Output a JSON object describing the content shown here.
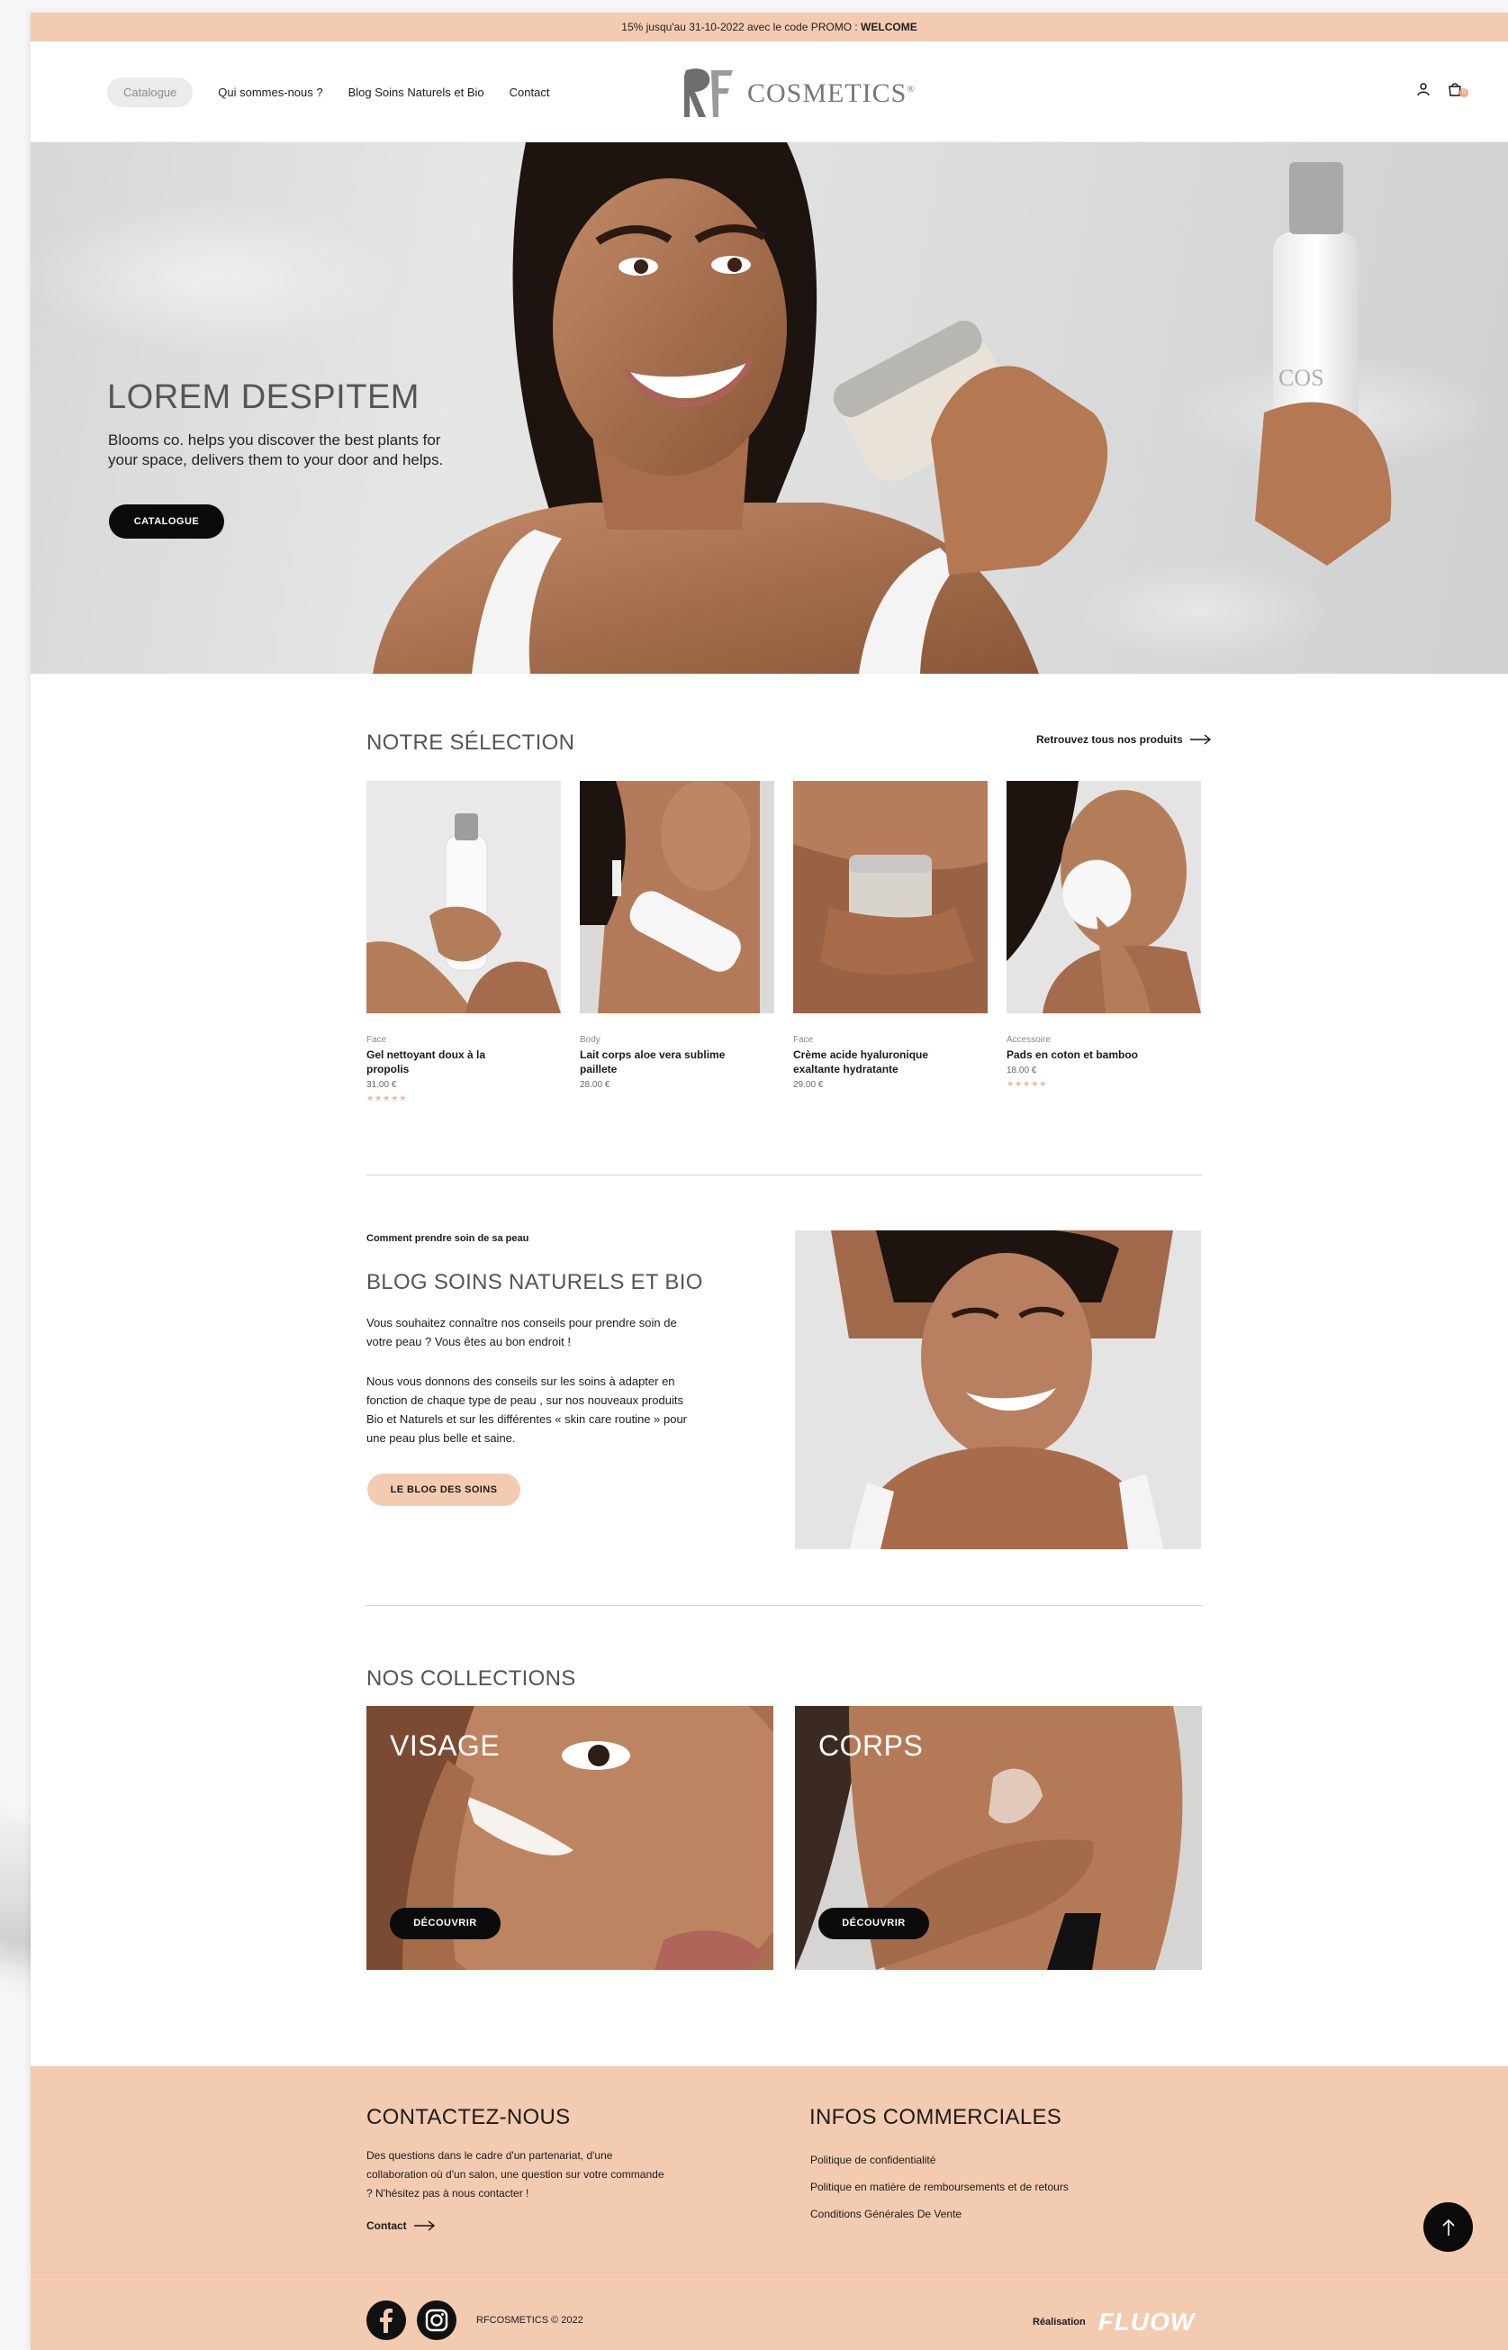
{
  "promo": {
    "text": "15% jusqu'au 31-10-2022 avec le code PROMO : ",
    "code": "WELCOME"
  },
  "nav": {
    "items": [
      {
        "label": "Catalogue",
        "active": true
      },
      {
        "label": "Qui sommes-nous ?"
      },
      {
        "label": "Blog Soins Naturels et Bio"
      },
      {
        "label": "Contact"
      }
    ],
    "logo_text": "COSMETICS",
    "logo_reg": "®",
    "cart_count": "0"
  },
  "hero": {
    "title": "LOREM DESPITEM",
    "subtitle": "Blooms co. helps you discover the best plants for your space, delivers them to your door and helps.",
    "button": "CATALOGUE"
  },
  "selection": {
    "title": "NOTRE SÉLECTION",
    "link": "Retrouvez tous nos produits",
    "products": [
      {
        "category": "Face",
        "name": "Gel nettoyant doux à la propolis",
        "price": "31.00 €",
        "stars": "★★★★★"
      },
      {
        "category": "Body",
        "name": "Lait corps aloe vera sublime paillete",
        "price": "28.00 €",
        "stars": ""
      },
      {
        "category": "Face",
        "name": "Crème acide hyaluronique exaltante hydratante",
        "price": "29.00 €",
        "stars": ""
      },
      {
        "category": "Accessoire",
        "name": "Pads en coton et bamboo",
        "price": "18.00 €",
        "stars": "★★★★★"
      }
    ]
  },
  "blog": {
    "kicker": "Comment prendre soin de sa peau",
    "title": "BLOG SOINS NATURELS ET BIO",
    "p1": "Vous souhaitez connaître nos conseils pour prendre soin de votre peau ? Vous êtes au bon endroit !",
    "p2": "Nous vous donnons des conseils sur les soins à adapter en fonction de chaque type de peau , sur nos nouveaux produits Bio et Naturels et sur les différentes « skin care routine » pour une peau plus belle et saine.",
    "button": "LE BLOG DES SOINS"
  },
  "collections": {
    "title": "NOS COLLECTIONS",
    "items": [
      {
        "label": "VISAGE",
        "button": "DÉCOUVRIR"
      },
      {
        "label": "CORPS",
        "button": "DÉCOUVRIR"
      }
    ]
  },
  "footer": {
    "contact_title": "CONTACTEZ-NOUS",
    "contact_text": "Des questions dans le cadre d'un partenariat, d'une collaboration où d'un salon, une question sur votre commande ? N'hésitez pas à nous contacter !",
    "contact_link": "Contact",
    "info_title": "INFOS COMMERCIALES",
    "info_links": [
      "Politique de confidentialité",
      "Politique en matière de remboursements et de retours",
      "Conditions Générales De Vente"
    ],
    "copyright": "RFCOSMETICS © 2022",
    "credit_label": "Réalisation",
    "credit_logo": "FLUOW"
  },
  "colors": {
    "peach": "#f3cbb1",
    "dark": "#0b0b0b",
    "accent_star": "#f3b48f"
  }
}
